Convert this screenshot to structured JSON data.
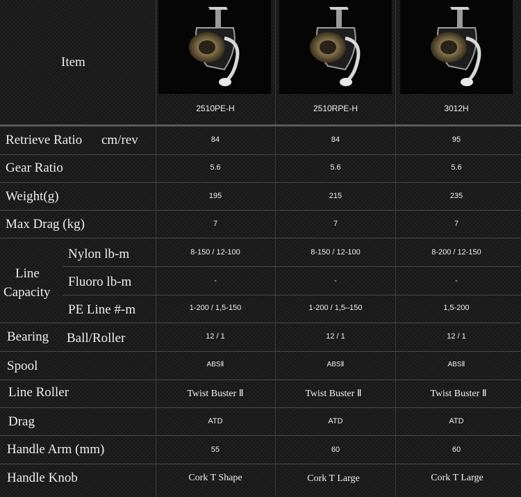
{
  "header": {
    "item_label": "Item",
    "models": [
      "2510PE-H",
      "2510RPE-H",
      "3012H"
    ],
    "photo_icons": [
      "spinning-reel-image",
      "spinning-reel-image",
      "spinning-reel-image"
    ]
  },
  "rows": {
    "retrieve": {
      "label": "Retrieve Ratio",
      "unit": "cm/rev",
      "values": [
        "84",
        "84",
        "95"
      ]
    },
    "gear": {
      "label": "Gear Ratio",
      "values": [
        "5.6",
        "5.6",
        "5.6"
      ]
    },
    "weight": {
      "label": "Weight(g)",
      "values": [
        "195",
        "215",
        "235"
      ]
    },
    "drag_max": {
      "label": "Max Drag (kg)",
      "values": [
        "7",
        "7",
        "7"
      ]
    },
    "line_capacity": {
      "label_line1": "Line",
      "label_line2": "Capacity",
      "nylon": {
        "label": "Nylon lb-m",
        "values": [
          "8-150 / 12-100",
          "8-150 / 12-100",
          "8-200 / 12-150"
        ]
      },
      "fluoro": {
        "label": "Fluoro lb-m",
        "values": [
          "-",
          "-",
          "-"
        ]
      },
      "pe": {
        "label": "PE Line #-m",
        "values": [
          "1-200 / 1,5-150",
          "1-200 / 1,5–150",
          "1,5-200"
        ]
      }
    },
    "bearing": {
      "label": "Bearing",
      "sublabel": "Ball/Roller",
      "values": [
        "12 / 1",
        "12 / 1",
        "12 / 1"
      ]
    },
    "spool": {
      "label": "Spool",
      "values": [
        "ABSⅡ",
        "ABSⅡ",
        "ABSⅡ"
      ]
    },
    "line_roller": {
      "label": "Line Roller",
      "values": [
        "Twist Buster Ⅱ",
        "Twist Buster Ⅱ",
        "Twist Buster Ⅱ"
      ]
    },
    "drag": {
      "label": "Drag",
      "values": [
        "ATD",
        "ATD",
        "ATD"
      ]
    },
    "handle_arm": {
      "label": "Handle Arm (mm)",
      "values": [
        "55",
        "60",
        "60"
      ]
    },
    "handle_knob": {
      "label": "Handle Knob",
      "values": [
        "Cork T Shape",
        "Cork T Large",
        "Cork T Large"
      ]
    }
  }
}
